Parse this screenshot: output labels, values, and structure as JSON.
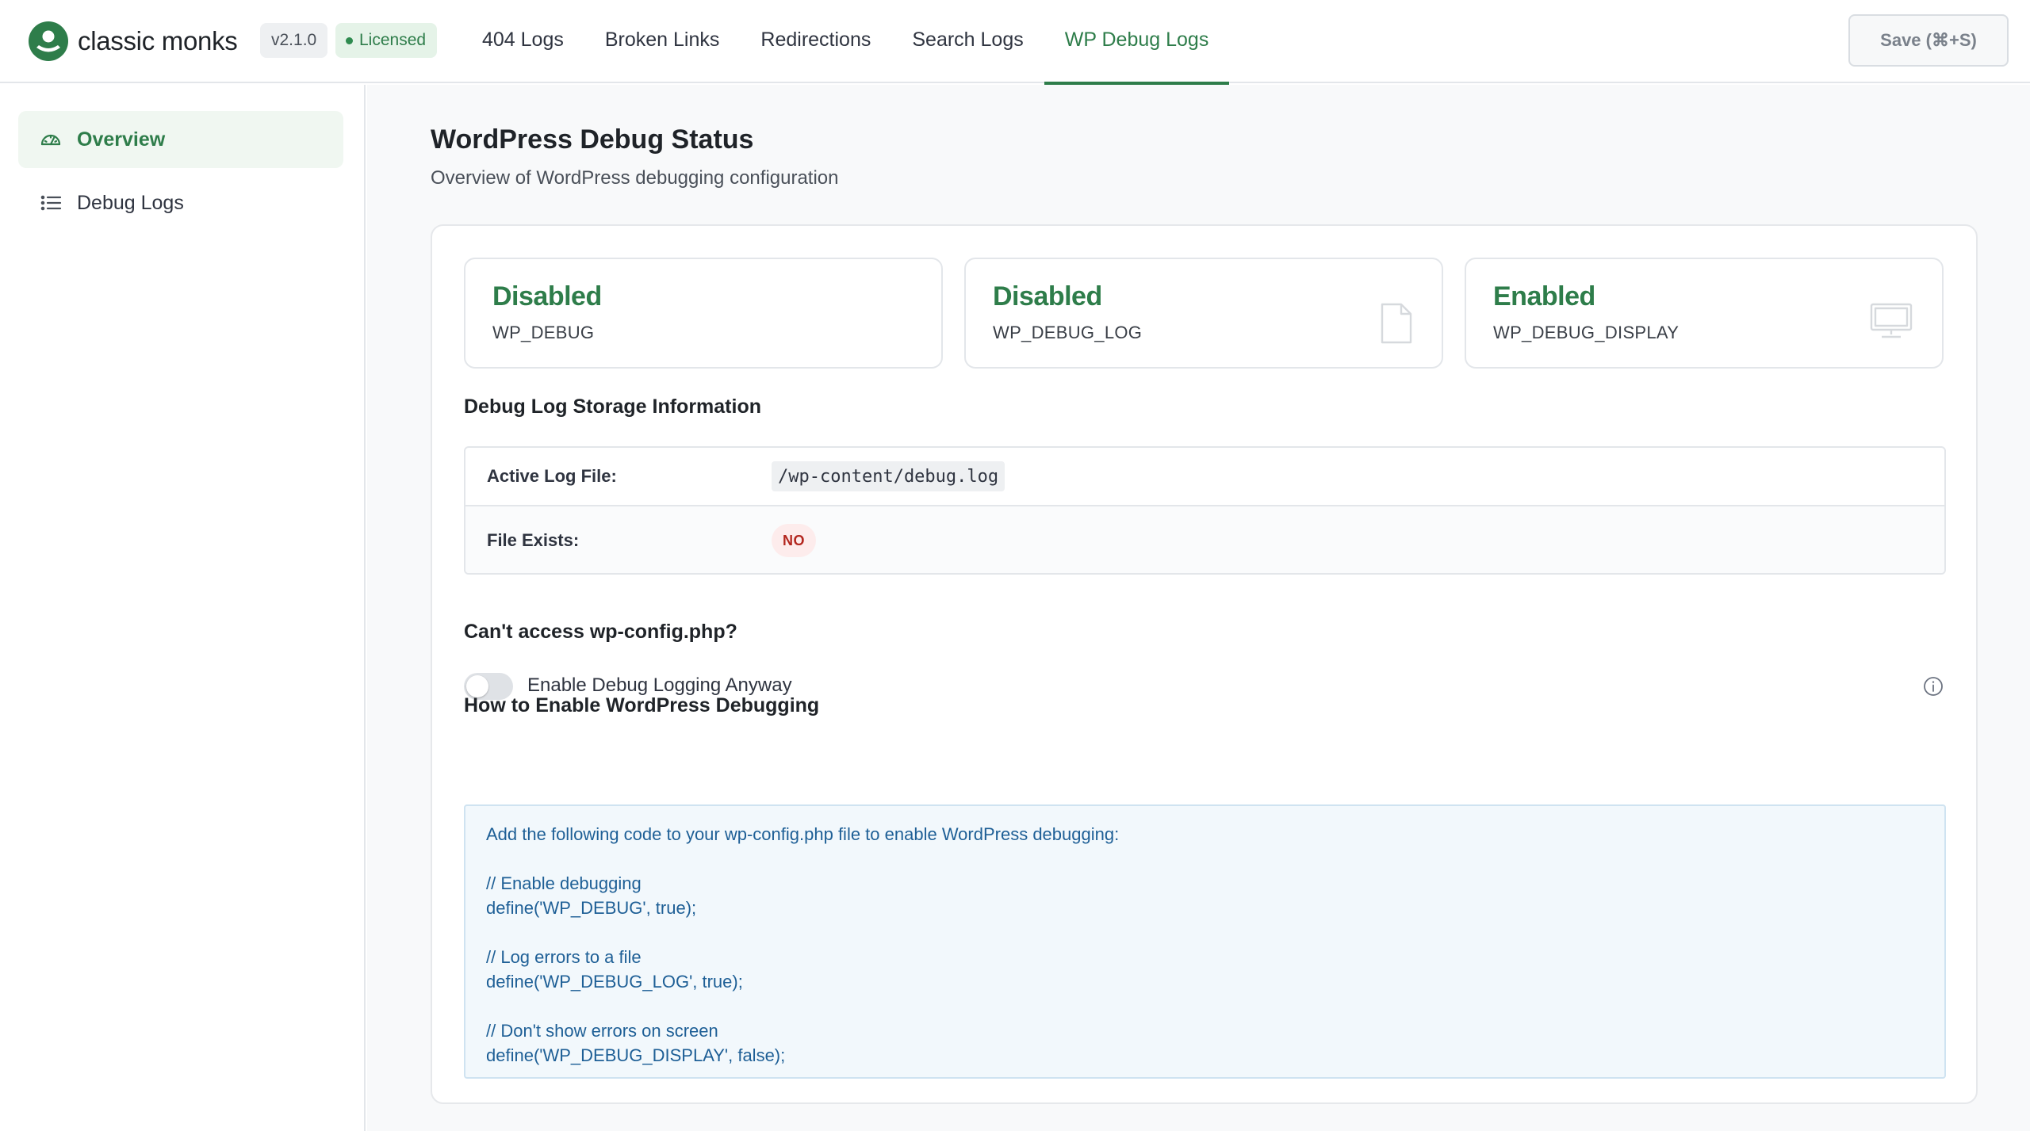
{
  "header": {
    "brand_name": "classic monks",
    "version": "v2.1.0",
    "license_status": "Licensed",
    "tabs": [
      {
        "label": "404 Logs",
        "active": false
      },
      {
        "label": "Broken Links",
        "active": false
      },
      {
        "label": "Redirections",
        "active": false
      },
      {
        "label": "Search Logs",
        "active": false
      },
      {
        "label": "WP Debug Logs",
        "active": true
      }
    ],
    "save_label": "Save (⌘+S)"
  },
  "sidebar": {
    "items": [
      {
        "label": "Overview",
        "icon": "gauge-icon",
        "active": true
      },
      {
        "label": "Debug Logs",
        "icon": "list-icon",
        "active": false
      }
    ]
  },
  "main": {
    "title": "WordPress Debug Status",
    "subtitle": "Overview of WordPress debugging configuration",
    "status_cards": [
      {
        "value": "Disabled",
        "label": "WP_DEBUG",
        "icon": ""
      },
      {
        "value": "Disabled",
        "label": "WP_DEBUG_LOG",
        "icon": "file-icon"
      },
      {
        "value": "Enabled",
        "label": "WP_DEBUG_DISPLAY",
        "icon": "monitor-icon"
      }
    ],
    "storage": {
      "heading": "Debug Log Storage Information",
      "active_log_label": "Active Log File:",
      "active_log_value": "/wp-content/debug.log",
      "file_exists_label": "File Exists:",
      "file_exists_value": "NO"
    },
    "config_access": {
      "heading": "Can't access wp-config.php?",
      "toggle_label": "Enable Debug Logging Anyway",
      "toggle_on": false
    },
    "howto": {
      "heading": "How to Enable WordPress Debugging",
      "lines": [
        "Add the following code to your wp-config.php file to enable WordPress debugging:",
        "",
        "// Enable debugging",
        "define('WP_DEBUG', true);",
        "",
        "// Log errors to a file",
        "define('WP_DEBUG_LOG', true);",
        "",
        "// Don't show errors on screen",
        "define('WP_DEBUG_DISPLAY', false);"
      ]
    }
  },
  "colors": {
    "accent": "#2e7d4a",
    "danger": "#b3261e",
    "code_text": "#1e5f96"
  }
}
